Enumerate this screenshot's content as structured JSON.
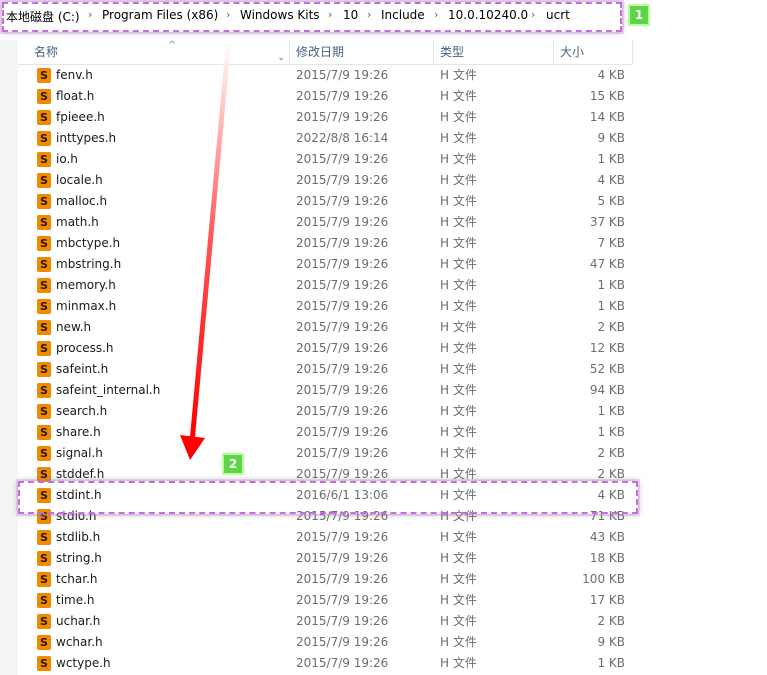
{
  "address_bar": {
    "crumbs": [
      "本地磁盘 (C:)",
      "Program Files (x86)",
      "Windows Kits",
      "10",
      "Include",
      "10.0.10240.0",
      "ucrt"
    ],
    "separator": "›"
  },
  "columns": {
    "name": "名称",
    "date": "修改日期",
    "type": "类型",
    "size": "大小"
  },
  "files": [
    {
      "name": "fenv.h",
      "date": "2015/7/9 19:26",
      "type": "H 文件",
      "size": "4 KB"
    },
    {
      "name": "float.h",
      "date": "2015/7/9 19:26",
      "type": "H 文件",
      "size": "15 KB"
    },
    {
      "name": "fpieee.h",
      "date": "2015/7/9 19:26",
      "type": "H 文件",
      "size": "14 KB"
    },
    {
      "name": "inttypes.h",
      "date": "2022/8/8 16:14",
      "type": "H 文件",
      "size": "9 KB"
    },
    {
      "name": "io.h",
      "date": "2015/7/9 19:26",
      "type": "H 文件",
      "size": "1 KB"
    },
    {
      "name": "locale.h",
      "date": "2015/7/9 19:26",
      "type": "H 文件",
      "size": "4 KB"
    },
    {
      "name": "malloc.h",
      "date": "2015/7/9 19:26",
      "type": "H 文件",
      "size": "5 KB"
    },
    {
      "name": "math.h",
      "date": "2015/7/9 19:26",
      "type": "H 文件",
      "size": "37 KB"
    },
    {
      "name": "mbctype.h",
      "date": "2015/7/9 19:26",
      "type": "H 文件",
      "size": "7 KB"
    },
    {
      "name": "mbstring.h",
      "date": "2015/7/9 19:26",
      "type": "H 文件",
      "size": "47 KB"
    },
    {
      "name": "memory.h",
      "date": "2015/7/9 19:26",
      "type": "H 文件",
      "size": "1 KB"
    },
    {
      "name": "minmax.h",
      "date": "2015/7/9 19:26",
      "type": "H 文件",
      "size": "1 KB"
    },
    {
      "name": "new.h",
      "date": "2015/7/9 19:26",
      "type": "H 文件",
      "size": "2 KB"
    },
    {
      "name": "process.h",
      "date": "2015/7/9 19:26",
      "type": "H 文件",
      "size": "12 KB"
    },
    {
      "name": "safeint.h",
      "date": "2015/7/9 19:26",
      "type": "H 文件",
      "size": "52 KB"
    },
    {
      "name": "safeint_internal.h",
      "date": "2015/7/9 19:26",
      "type": "H 文件",
      "size": "94 KB"
    },
    {
      "name": "search.h",
      "date": "2015/7/9 19:26",
      "type": "H 文件",
      "size": "1 KB"
    },
    {
      "name": "share.h",
      "date": "2015/7/9 19:26",
      "type": "H 文件",
      "size": "1 KB"
    },
    {
      "name": "signal.h",
      "date": "2015/7/9 19:26",
      "type": "H 文件",
      "size": "2 KB"
    },
    {
      "name": "stddef.h",
      "date": "2015/7/9 19:26",
      "type": "H 文件",
      "size": "2 KB"
    },
    {
      "name": "stdint.h",
      "date": "2016/6/1 13:06",
      "type": "H 文件",
      "size": "4 KB"
    },
    {
      "name": "stdio.h",
      "date": "2015/7/9 19:26",
      "type": "H 文件",
      "size": "71 KB"
    },
    {
      "name": "stdlib.h",
      "date": "2015/7/9 19:26",
      "type": "H 文件",
      "size": "43 KB"
    },
    {
      "name": "string.h",
      "date": "2015/7/9 19:26",
      "type": "H 文件",
      "size": "18 KB"
    },
    {
      "name": "tchar.h",
      "date": "2015/7/9 19:26",
      "type": "H 文件",
      "size": "100 KB"
    },
    {
      "name": "time.h",
      "date": "2015/7/9 19:26",
      "type": "H 文件",
      "size": "17 KB"
    },
    {
      "name": "uchar.h",
      "date": "2015/7/9 19:26",
      "type": "H 文件",
      "size": "2 KB"
    },
    {
      "name": "wchar.h",
      "date": "2015/7/9 19:26",
      "type": "H 文件",
      "size": "9 KB"
    },
    {
      "name": "wctype.h",
      "date": "2015/7/9 19:26",
      "type": "H 文件",
      "size": "1 KB"
    }
  ],
  "file_icon": {
    "name": "sublime-file-icon",
    "glyph": "S",
    "color": "#f08a00"
  },
  "annotations": {
    "badge_1": "1",
    "badge_2": "2",
    "highlight_color": "#c76be0",
    "badge_color": "#5fd34a",
    "arrow_color": "#ff0000"
  }
}
